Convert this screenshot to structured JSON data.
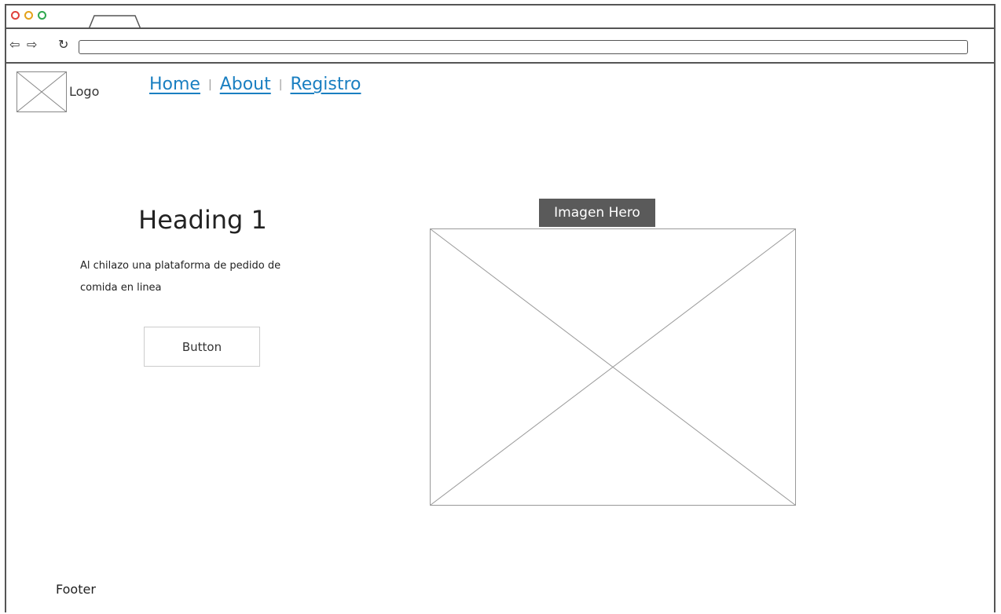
{
  "browser": {
    "url": "",
    "window_controls": {
      "close_color": "#e0413c",
      "minimize_color": "#e3a21a",
      "maximize_color": "#2fa84f"
    },
    "icons": {
      "back": "back-arrow-icon",
      "forward": "forward-arrow-icon",
      "refresh": "refresh-icon"
    }
  },
  "header": {
    "logo_label": "Logo",
    "nav": {
      "home": "Home",
      "about": "About",
      "registro": "Registro",
      "link_color": "#1a7fc1"
    }
  },
  "hero": {
    "heading": "Heading 1",
    "description": "Al chilazo una plataforma de pedido de comida en linea",
    "button_label": "Button",
    "image_label": "Imagen Hero",
    "image_label_bg": "#5a5a5a"
  },
  "footer": {
    "text": "Footer"
  }
}
